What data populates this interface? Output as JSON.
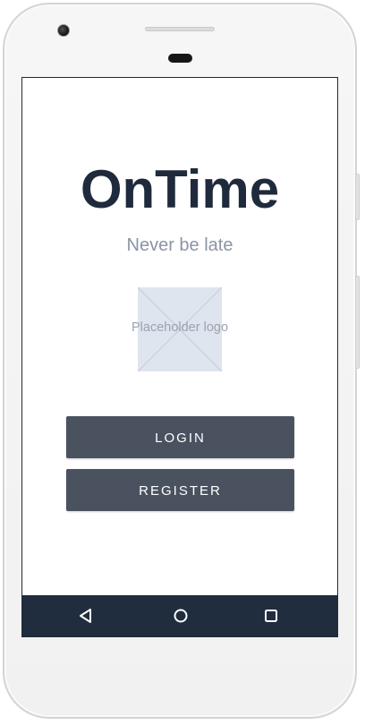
{
  "app": {
    "title": "OnTime",
    "tagline": "Never be late"
  },
  "logo": {
    "placeholder_label": "Placeholder logo"
  },
  "actions": {
    "login_label": "LOGIN",
    "register_label": "REGISTER"
  },
  "navigation": {
    "back_icon": "triangle-back-icon",
    "home_icon": "circle-home-icon",
    "recents_icon": "square-recents-icon"
  },
  "colors": {
    "title": "#1f2b3c",
    "tagline": "#8a94a6",
    "button": "#4a5260",
    "navbar": "#1f2d3f",
    "logo_placeholder": "#dfe5ee"
  }
}
